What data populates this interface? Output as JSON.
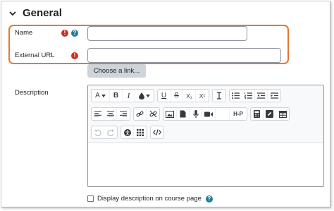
{
  "section": {
    "title": "General"
  },
  "fields": {
    "name": {
      "label": "Name",
      "required_mark": "!",
      "help_mark": "?",
      "value": "",
      "placeholder": ""
    },
    "external_url": {
      "label": "External URL",
      "required_mark": "!",
      "value": "",
      "placeholder": ""
    },
    "choose_link_label": "Choose a link...",
    "description": {
      "label": "Description"
    }
  },
  "toolbar": {
    "row1": {
      "font_label": "A",
      "bold": "B",
      "italic": "I",
      "underline": "U",
      "strike": "S",
      "subscript": "X₁",
      "superscript": "X¹"
    },
    "row2": {
      "h5p_label": "H-P"
    }
  },
  "checkbox": {
    "label": "Display description on course page",
    "help_mark": "?"
  },
  "colors": {
    "highlight": "#e8772e",
    "required": "#ca3120",
    "help": "#1f7e9a"
  }
}
